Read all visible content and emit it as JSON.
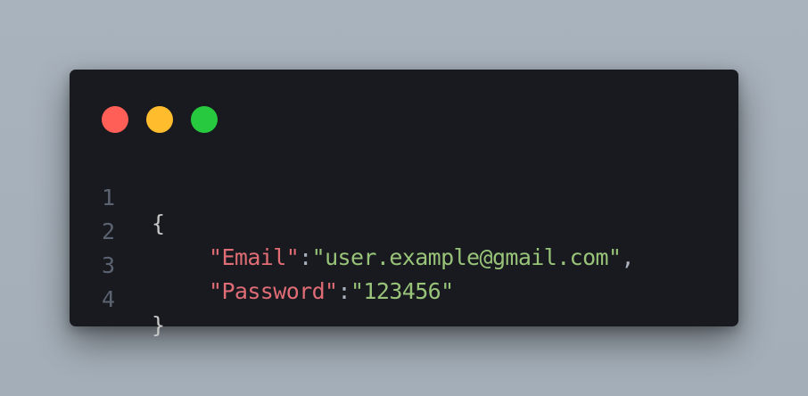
{
  "window": {
    "controls": [
      {
        "name": "close",
        "color": "#ff5f56"
      },
      {
        "name": "minimize",
        "color": "#ffbd2e"
      },
      {
        "name": "maximize",
        "color": "#27c93f"
      }
    ]
  },
  "code": {
    "lines": [
      {
        "number": "1",
        "text": "{"
      },
      {
        "number": "2",
        "key": "\"Email\"",
        "colon": ":",
        "value": "\"user.example@gmail.com\"",
        "comma": ","
      },
      {
        "number": "3",
        "key": "\"Password\"",
        "colon": ":",
        "value": "\"123456\""
      },
      {
        "number": "4",
        "text": "}"
      }
    ]
  },
  "colors": {
    "background": "#a9b3bd",
    "window": "#181a1f",
    "line_number": "#5c6370",
    "key": "#e06c75",
    "string": "#98c379",
    "punctuation": "#abb2bf"
  }
}
